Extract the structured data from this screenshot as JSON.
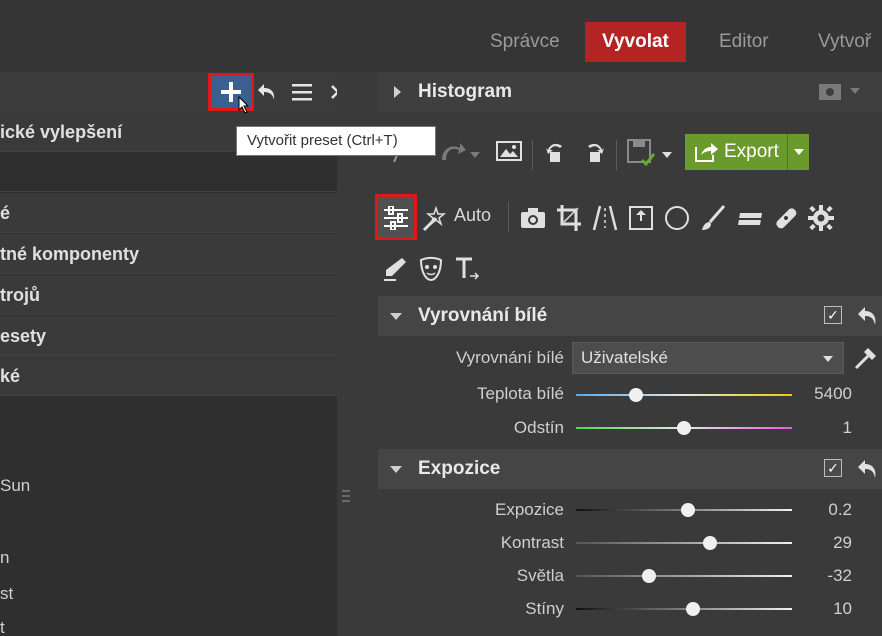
{
  "nav": {
    "tabs": [
      {
        "label": "Správce"
      },
      {
        "label": "Vyvolat"
      },
      {
        "label": "Editor"
      },
      {
        "label": "Vytvoř"
      }
    ],
    "active": "Vyvolat"
  },
  "left_panel": {
    "toolbar": {
      "add_icon": "plus-icon",
      "undo_icon": "undo-icon",
      "menu_icon": "menu-icon",
      "close_icon": "close-icon"
    },
    "tooltip": "Vytvořit preset (Ctrl+T)",
    "groups": [
      {
        "label": "ické vylepšení"
      },
      {
        "label": ""
      },
      {
        "label": "é"
      },
      {
        "label": "tné komponenty"
      },
      {
        "label": "trojů"
      },
      {
        "label": "esety"
      },
      {
        "label": "ké"
      }
    ],
    "items": [
      {
        "label": "Sun"
      },
      {
        "label": "n"
      },
      {
        "label": "st"
      },
      {
        "label": "t"
      }
    ]
  },
  "right_panel": {
    "histogram": {
      "title": "Histogram"
    },
    "toolbar": {
      "export_label": "Export",
      "auto_label": "Auto"
    },
    "white_balance": {
      "title": "Vyrovnání bílé",
      "checked": true,
      "mode_label": "Vyrovnání bílé",
      "mode_value": "Uživatelské",
      "rows": [
        {
          "label": "Teplota bílé",
          "value": "5400",
          "fraction": 0.28
        },
        {
          "label": "Odstín",
          "value": "1",
          "fraction": 0.5
        }
      ]
    },
    "exposure": {
      "title": "Expozice",
      "checked": true,
      "rows": [
        {
          "label": "Expozice",
          "value": "0.2",
          "fraction": 0.52
        },
        {
          "label": "Kontrast",
          "value": "29",
          "fraction": 0.62
        },
        {
          "label": "Světla",
          "value": "-32",
          "fraction": 0.34
        },
        {
          "label": "Stíny",
          "value": "10",
          "fraction": 0.54
        }
      ]
    }
  },
  "colors": {
    "active_tab": "#b42424",
    "export": "#6a9a2b",
    "highlight": "#e01818",
    "add_button": "#3b5f8e"
  }
}
